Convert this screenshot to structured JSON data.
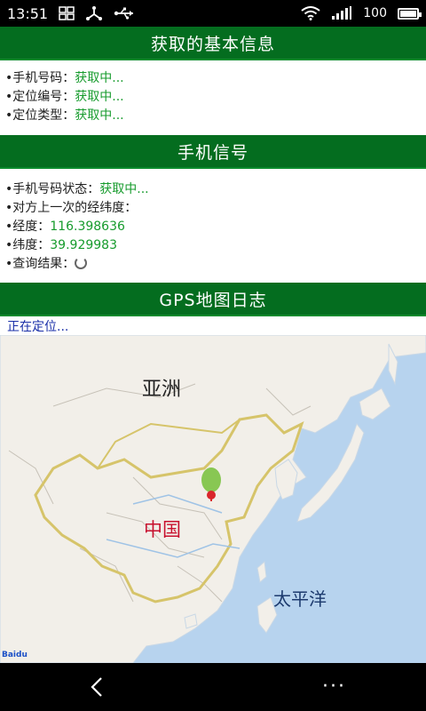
{
  "status_bar": {
    "time": "13:51",
    "battery_text": "100",
    "battery_level": 1.0,
    "icons": [
      "grid-icon",
      "usb-tether-icon",
      "usb-icon",
      "wifi-icon",
      "signal-icon",
      "battery-icon"
    ]
  },
  "section1": {
    "title": "获取的基本信息",
    "rows": [
      {
        "label": "•手机号码：",
        "value": "获取中..."
      },
      {
        "label": "•定位编号：",
        "value": "获取中..."
      },
      {
        "label": "•定位类型：",
        "value": "获取中..."
      }
    ]
  },
  "section2": {
    "title": "手机信号",
    "rows": [
      {
        "label": "•手机号码状态：",
        "value": "获取中..."
      },
      {
        "label": "•对方上一次的经纬度：",
        "value": ""
      },
      {
        "label": "•经度：",
        "value": "116.398636"
      },
      {
        "label": "•纬度：",
        "value": "39.929983"
      },
      {
        "label": "•查询结果：",
        "value": ""
      }
    ]
  },
  "section3": {
    "title": "GPS地图日志",
    "status": "正在定位..."
  },
  "map": {
    "labels": {
      "asia": "亚洲",
      "china": "中国",
      "pacific": "太平洋"
    },
    "logo": "Baidu",
    "colors": {
      "water": "#b7d3ee",
      "land": "#f2efe9",
      "border": "#d6c46a",
      "marker": "#7cc242"
    }
  },
  "nav": {
    "back_icon": "back-icon",
    "menu_label": "···"
  },
  "colors": {
    "header_bg": "#046d1f",
    "value_green": "#169b2c",
    "locating_blue": "#1a2fa8"
  }
}
